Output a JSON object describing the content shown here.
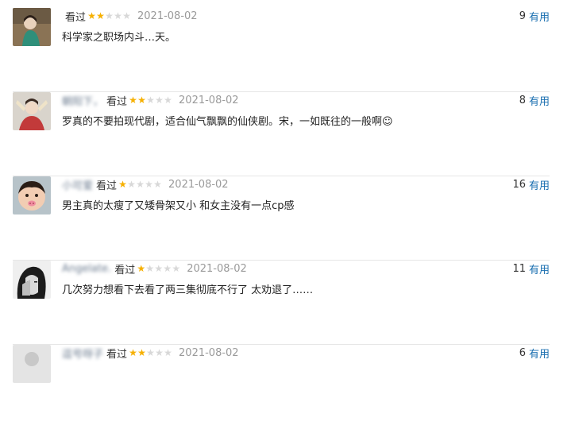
{
  "reviews": [
    {
      "user": "",
      "status": "看过",
      "rating": 2,
      "date": "2021-08-02",
      "votes": "9",
      "useful_label": "有用",
      "text": "科学家之职场内斗…天。"
    },
    {
      "user": "朝阳下，",
      "status": "看过",
      "rating": 2,
      "date": "2021-08-02",
      "votes": "8",
      "useful_label": "有用",
      "text": "罗真的不要拍现代剧，适合仙气飘飘的仙侠剧。宋，一如既往的一般啊☺"
    },
    {
      "user": "小可爱",
      "status": "看过",
      "rating": 1,
      "date": "2021-08-02",
      "votes": "16",
      "useful_label": "有用",
      "text": "男主真的太瘦了又矮骨架又小 和女主没有一点cp感"
    },
    {
      "user": "Angelate.",
      "status": "看过",
      "rating": 1,
      "date": "2021-08-02",
      "votes": "11",
      "useful_label": "有用",
      "text": "几次努力想看下去看了两三集彻底不行了 太劝退了……"
    },
    {
      "user": "逗号呀子",
      "status": "看过",
      "rating": 2,
      "date": "2021-08-02",
      "votes": "6",
      "useful_label": "有用",
      "text": ""
    }
  ],
  "colors": {
    "star_on": "#f6b000",
    "star_off": "#d8d8d8",
    "useful_link": "#1a6fb0"
  },
  "icons": {
    "star": "star-icon"
  }
}
